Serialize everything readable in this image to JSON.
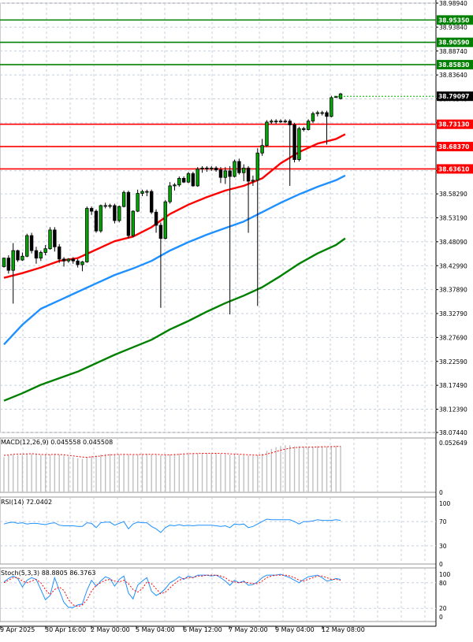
{
  "chart_data": [
    {
      "type": "candlestick",
      "panel": "price",
      "x_tick_labels": [
        "9 Apr 2025",
        "30 Apr 16:00",
        "2 May 00:00",
        "5 May 04:00",
        "6 May 12:00",
        "7 May 20:00",
        "9 May 04:00",
        "12 May 08:00"
      ],
      "y_tick_labels": [
        "38.98940",
        "38.93840",
        "38.88740",
        "38.83640",
        "38.78540",
        "38.73430",
        "38.68330",
        "38.63230",
        "38.58290",
        "38.53190",
        "38.48090",
        "38.42990",
        "38.37890",
        "38.32790",
        "38.27690",
        "38.22590",
        "38.17490",
        "38.12390",
        "38.07440"
      ],
      "ylim": [
        38.0744,
        38.9894
      ],
      "grid": true,
      "support_resistance": [
        {
          "value": 38.9535,
          "label": "38.95350",
          "color": "#008000"
        },
        {
          "value": 38.9059,
          "label": "38.90590",
          "color": "#008000"
        },
        {
          "value": 38.8583,
          "label": "38.85830",
          "color": "#008000"
        },
        {
          "value": 38.7313,
          "label": "38.73130",
          "color": "#ff0000"
        },
        {
          "value": 38.6837,
          "label": "38.68370",
          "color": "#ff0000"
        },
        {
          "value": 38.6361,
          "label": "38.63610",
          "color": "#ff0000"
        }
      ],
      "current_price": {
        "value": 38.79097,
        "label": "38.79097"
      },
      "candles": [
        [
          38.428,
          38.447,
          38.426,
          38.446
        ],
        [
          38.446,
          38.452,
          38.413,
          38.42
        ],
        [
          38.42,
          38.478,
          38.349,
          38.462
        ],
        [
          38.462,
          38.464,
          38.438,
          38.442
        ],
        [
          38.442,
          38.458,
          38.44,
          38.45
        ],
        [
          38.45,
          38.498,
          38.448,
          38.494
        ],
        [
          38.494,
          38.5,
          38.456,
          38.462
        ],
        [
          38.462,
          38.47,
          38.434,
          38.446
        ],
        [
          38.446,
          38.462,
          38.44,
          38.458
        ],
        [
          38.458,
          38.474,
          38.452,
          38.466
        ],
        [
          38.466,
          38.512,
          38.464,
          38.506
        ],
        [
          38.506,
          38.512,
          38.46,
          38.47
        ],
        [
          38.47,
          38.476,
          38.436,
          38.444
        ],
        [
          38.444,
          38.448,
          38.428,
          38.44
        ],
        [
          38.44,
          38.446,
          38.436,
          38.444
        ],
        [
          38.444,
          38.448,
          38.434,
          38.44
        ],
        [
          38.44,
          38.444,
          38.426,
          38.432
        ],
        [
          38.432,
          38.44,
          38.418,
          38.438
        ],
        [
          38.438,
          38.556,
          38.436,
          38.552
        ],
        [
          38.552,
          38.556,
          38.538,
          38.546
        ],
        [
          38.546,
          38.55,
          38.5,
          38.504
        ],
        [
          38.504,
          38.56,
          38.5,
          38.558
        ],
        [
          38.558,
          38.564,
          38.552,
          38.558
        ],
        [
          38.558,
          38.562,
          38.552,
          38.558
        ],
        [
          38.558,
          38.562,
          38.52,
          38.526
        ],
        [
          38.526,
          38.558,
          38.522,
          38.556
        ],
        [
          38.556,
          38.59,
          38.554,
          38.586
        ],
        [
          38.586,
          38.59,
          38.488,
          38.494
        ],
        [
          38.494,
          38.548,
          38.49,
          38.546
        ],
        [
          38.546,
          38.592,
          38.544,
          38.584
        ],
        [
          38.584,
          38.592,
          38.578,
          38.588
        ],
        [
          38.588,
          38.592,
          38.578,
          38.588
        ],
        [
          38.588,
          38.592,
          38.54,
          38.544
        ],
        [
          38.544,
          38.55,
          38.5,
          38.516
        ],
        [
          38.516,
          38.522,
          38.34,
          38.488
        ],
        [
          38.488,
          38.57,
          38.486,
          38.566
        ],
        [
          38.566,
          38.608,
          38.562,
          38.6
        ],
        [
          38.6,
          38.606,
          38.59,
          38.602
        ],
        [
          38.602,
          38.62,
          38.598,
          38.616
        ],
        [
          38.616,
          38.62,
          38.606,
          38.608
        ],
        [
          38.608,
          38.63,
          38.606,
          38.626
        ],
        [
          38.626,
          38.63,
          38.598,
          38.6
        ],
        [
          38.6,
          38.64,
          38.598,
          38.636
        ],
        [
          38.636,
          38.642,
          38.628,
          38.638
        ],
        [
          38.638,
          38.642,
          38.63,
          38.636
        ],
        [
          38.636,
          38.642,
          38.632,
          38.638
        ],
        [
          38.638,
          38.642,
          38.63,
          38.634
        ],
        [
          38.634,
          38.64,
          38.606,
          38.618
        ],
        [
          38.618,
          38.64,
          38.604,
          38.632
        ],
        [
          38.632,
          38.642,
          38.326,
          38.62
        ],
        [
          38.62,
          38.656,
          38.618,
          38.652
        ],
        [
          38.652,
          38.658,
          38.624,
          38.628
        ],
        [
          38.628,
          38.646,
          38.61,
          38.638
        ],
        [
          38.638,
          38.642,
          38.5,
          38.61
        ],
        [
          38.61,
          38.622,
          38.6,
          38.612
        ],
        [
          38.612,
          38.68,
          38.344,
          38.67
        ],
        [
          38.67,
          38.7,
          38.664,
          38.686
        ],
        [
          38.686,
          38.74,
          38.682,
          38.736
        ],
        [
          38.736,
          38.742,
          38.732,
          38.738
        ],
        [
          38.738,
          38.742,
          38.732,
          38.738
        ],
        [
          38.738,
          38.742,
          38.734,
          38.738
        ],
        [
          38.738,
          38.742,
          38.734,
          38.738
        ],
        [
          38.738,
          38.742,
          38.6,
          38.73
        ],
        [
          38.73,
          38.734,
          38.65,
          38.656
        ],
        [
          38.656,
          38.726,
          38.652,
          38.722
        ],
        [
          38.722,
          38.726,
          38.716,
          38.72
        ],
        [
          38.72,
          38.742,
          38.718,
          38.738
        ],
        [
          38.738,
          38.758,
          38.734,
          38.754
        ],
        [
          38.754,
          38.76,
          38.748,
          38.756
        ],
        [
          38.756,
          38.76,
          38.75,
          38.756
        ],
        [
          38.756,
          38.76,
          38.688,
          38.748
        ],
        [
          38.748,
          38.792,
          38.746,
          38.788
        ],
        [
          38.79,
          38.792,
          38.788,
          38.79
        ],
        [
          38.786,
          38.798,
          38.784,
          38.796
        ]
      ],
      "moving_averages": [
        {
          "color": "#ff0000",
          "points": [
            [
              0,
              38.404
            ],
            [
              4,
              38.414
            ],
            [
              8,
              38.426
            ],
            [
              12,
              38.44
            ],
            [
              16,
              38.446
            ],
            [
              20,
              38.464
            ],
            [
              24,
              38.482
            ],
            [
              28,
              38.492
            ],
            [
              32,
              38.512
            ],
            [
              36,
              38.54
            ],
            [
              40,
              38.56
            ],
            [
              44,
              38.576
            ],
            [
              48,
              38.59
            ],
            [
              52,
              38.6
            ],
            [
              56,
              38.616
            ],
            [
              60,
              38.648
            ],
            [
              64,
              38.672
            ],
            [
              68,
              38.69
            ],
            [
              72,
              38.7
            ],
            [
              74,
              38.71
            ]
          ]
        },
        {
          "color": "#1e90ff",
          "points": [
            [
              0,
              38.262
            ],
            [
              4,
              38.304
            ],
            [
              8,
              38.338
            ],
            [
              12,
              38.356
            ],
            [
              16,
              38.374
            ],
            [
              20,
              38.392
            ],
            [
              24,
              38.41
            ],
            [
              28,
              38.424
            ],
            [
              32,
              38.44
            ],
            [
              36,
              38.462
            ],
            [
              40,
              38.48
            ],
            [
              44,
              38.496
            ],
            [
              48,
              38.51
            ],
            [
              52,
              38.524
            ],
            [
              56,
              38.544
            ],
            [
              60,
              38.564
            ],
            [
              64,
              38.582
            ],
            [
              68,
              38.598
            ],
            [
              72,
              38.612
            ],
            [
              74,
              38.622
            ]
          ]
        },
        {
          "color": "#008000",
          "points": [
            [
              0,
              38.142
            ],
            [
              4,
              38.158
            ],
            [
              8,
              38.176
            ],
            [
              12,
              38.19
            ],
            [
              16,
              38.204
            ],
            [
              20,
              38.222
            ],
            [
              24,
              38.24
            ],
            [
              28,
              38.256
            ],
            [
              32,
              38.272
            ],
            [
              36,
              38.294
            ],
            [
              40,
              38.312
            ],
            [
              44,
              38.332
            ],
            [
              48,
              38.35
            ],
            [
              52,
              38.366
            ],
            [
              56,
              38.384
            ],
            [
              60,
              38.408
            ],
            [
              64,
              38.434
            ],
            [
              68,
              38.456
            ],
            [
              72,
              38.474
            ],
            [
              74,
              38.488
            ]
          ]
        }
      ]
    },
    {
      "type": "bar",
      "panel": "macd",
      "label": "MACD(12,26,9) 0.045558 0.045508",
      "y_tick_labels": [
        "0.052649",
        "0"
      ],
      "ylim": [
        0,
        0.052649
      ],
      "histogram_color": "#c0c0c0",
      "signal_color": "#ff0000",
      "values": [
        0.0373,
        0.0392,
        0.0398,
        0.0396,
        0.0398,
        0.0404,
        0.0408,
        0.0402,
        0.0398,
        0.0396,
        0.0402,
        0.0407,
        0.0398,
        0.0389,
        0.038,
        0.0372,
        0.0363,
        0.0355,
        0.0369,
        0.0386,
        0.0392,
        0.04,
        0.0406,
        0.041,
        0.0406,
        0.0403,
        0.0408,
        0.04,
        0.0396,
        0.0402,
        0.0406,
        0.0408,
        0.0402,
        0.0398,
        0.0393,
        0.0396,
        0.0403,
        0.0408,
        0.0412,
        0.0414,
        0.0416,
        0.0414,
        0.0415,
        0.0416,
        0.0414,
        0.0413,
        0.0412,
        0.0408,
        0.0406,
        0.0398,
        0.0403,
        0.0398,
        0.0396,
        0.0389,
        0.0388,
        0.0396,
        0.041,
        0.044,
        0.046,
        0.048,
        0.0492,
        0.05,
        0.05,
        0.049,
        0.0488,
        0.0482,
        0.048,
        0.0483,
        0.0488,
        0.049,
        0.0486,
        0.049,
        0.0493,
        0.0492
      ],
      "signal": [
        0.0392,
        0.0396,
        0.0404,
        0.0406,
        0.0406,
        0.0408,
        0.041,
        0.0406,
        0.0402,
        0.04,
        0.04,
        0.0403,
        0.0401,
        0.0398,
        0.0392,
        0.0386,
        0.038,
        0.0374,
        0.0372,
        0.0376,
        0.038,
        0.0386,
        0.0392,
        0.0398,
        0.04,
        0.0402,
        0.0403,
        0.0402,
        0.0401,
        0.0401,
        0.0402,
        0.0404,
        0.0404,
        0.0403,
        0.04,
        0.0398,
        0.0398,
        0.04,
        0.0403,
        0.0407,
        0.041,
        0.0411,
        0.0412,
        0.0414,
        0.0414,
        0.0414,
        0.0414,
        0.0413,
        0.0412,
        0.0408,
        0.0406,
        0.0404,
        0.0402,
        0.0399,
        0.0396,
        0.0394,
        0.0396,
        0.0406,
        0.0418,
        0.0432,
        0.0446,
        0.0458,
        0.0468,
        0.0474,
        0.0478,
        0.048,
        0.048,
        0.048,
        0.0481,
        0.0483,
        0.0484,
        0.0485,
        0.0486,
        0.0486
      ]
    },
    {
      "type": "line",
      "panel": "rsi",
      "label": "RSI(14) 72.0402",
      "y_tick_labels": [
        "100",
        "70",
        "30",
        "0"
      ],
      "ylim": [
        0,
        100
      ],
      "levels": [
        70,
        30
      ],
      "color": "#1e90ff",
      "values": [
        66,
        68,
        69,
        67,
        68,
        66,
        67,
        67,
        66,
        65,
        67,
        68,
        64,
        63,
        63,
        63,
        62,
        62,
        68,
        67,
        60,
        68,
        69,
        69,
        64,
        67,
        70,
        58,
        66,
        69,
        68,
        68,
        62,
        58,
        52,
        60,
        64,
        63,
        65,
        63,
        64,
        63,
        64,
        64,
        64,
        64,
        63,
        62,
        63,
        60,
        66,
        65,
        66,
        60,
        62,
        66,
        70,
        74,
        73,
        73,
        73,
        73,
        73,
        70,
        66,
        70,
        70,
        71,
        73,
        72,
        72,
        72,
        73,
        72
      ]
    },
    {
      "type": "line",
      "panel": "stochastic",
      "label": "Stoch(5,3,3) 88.8805 86.3763",
      "y_tick_labels": [
        "100",
        "80",
        "20",
        "0"
      ],
      "ylim": [
        0,
        100
      ],
      "levels": [
        80,
        20
      ],
      "series": [
        {
          "color": "#1e90ff",
          "values": [
            82,
            90,
            96,
            90,
            70,
            86,
            92,
            88,
            64,
            40,
            50,
            92,
            62,
            34,
            22,
            22,
            28,
            30,
            62,
            86,
            72,
            84,
            94,
            90,
            72,
            88,
            96,
            56,
            42,
            74,
            84,
            92,
            60,
            50,
            56,
            66,
            80,
            86,
            94,
            88,
            96,
            92,
            98,
            98,
            98,
            96,
            98,
            92,
            84,
            74,
            86,
            80,
            84,
            74,
            76,
            82,
            92,
            98,
            98,
            98,
            100,
            96,
            92,
            86,
            80,
            88,
            94,
            96,
            98,
            92,
            84,
            86,
            90,
            88
          ]
        },
        {
          "color": "#ff0000",
          "values": [
            80,
            86,
            92,
            92,
            84,
            80,
            84,
            88,
            80,
            64,
            52,
            64,
            70,
            62,
            40,
            28,
            24,
            28,
            40,
            60,
            74,
            80,
            86,
            88,
            84,
            82,
            86,
            78,
            64,
            58,
            66,
            82,
            78,
            66,
            54,
            58,
            68,
            78,
            86,
            90,
            92,
            92,
            96,
            96,
            98,
            98,
            98,
            96,
            92,
            84,
            82,
            80,
            82,
            80,
            78,
            78,
            84,
            92,
            96,
            98,
            98,
            98,
            96,
            92,
            86,
            84,
            88,
            92,
            96,
            96,
            92,
            88,
            88,
            86
          ]
        }
      ]
    }
  ]
}
